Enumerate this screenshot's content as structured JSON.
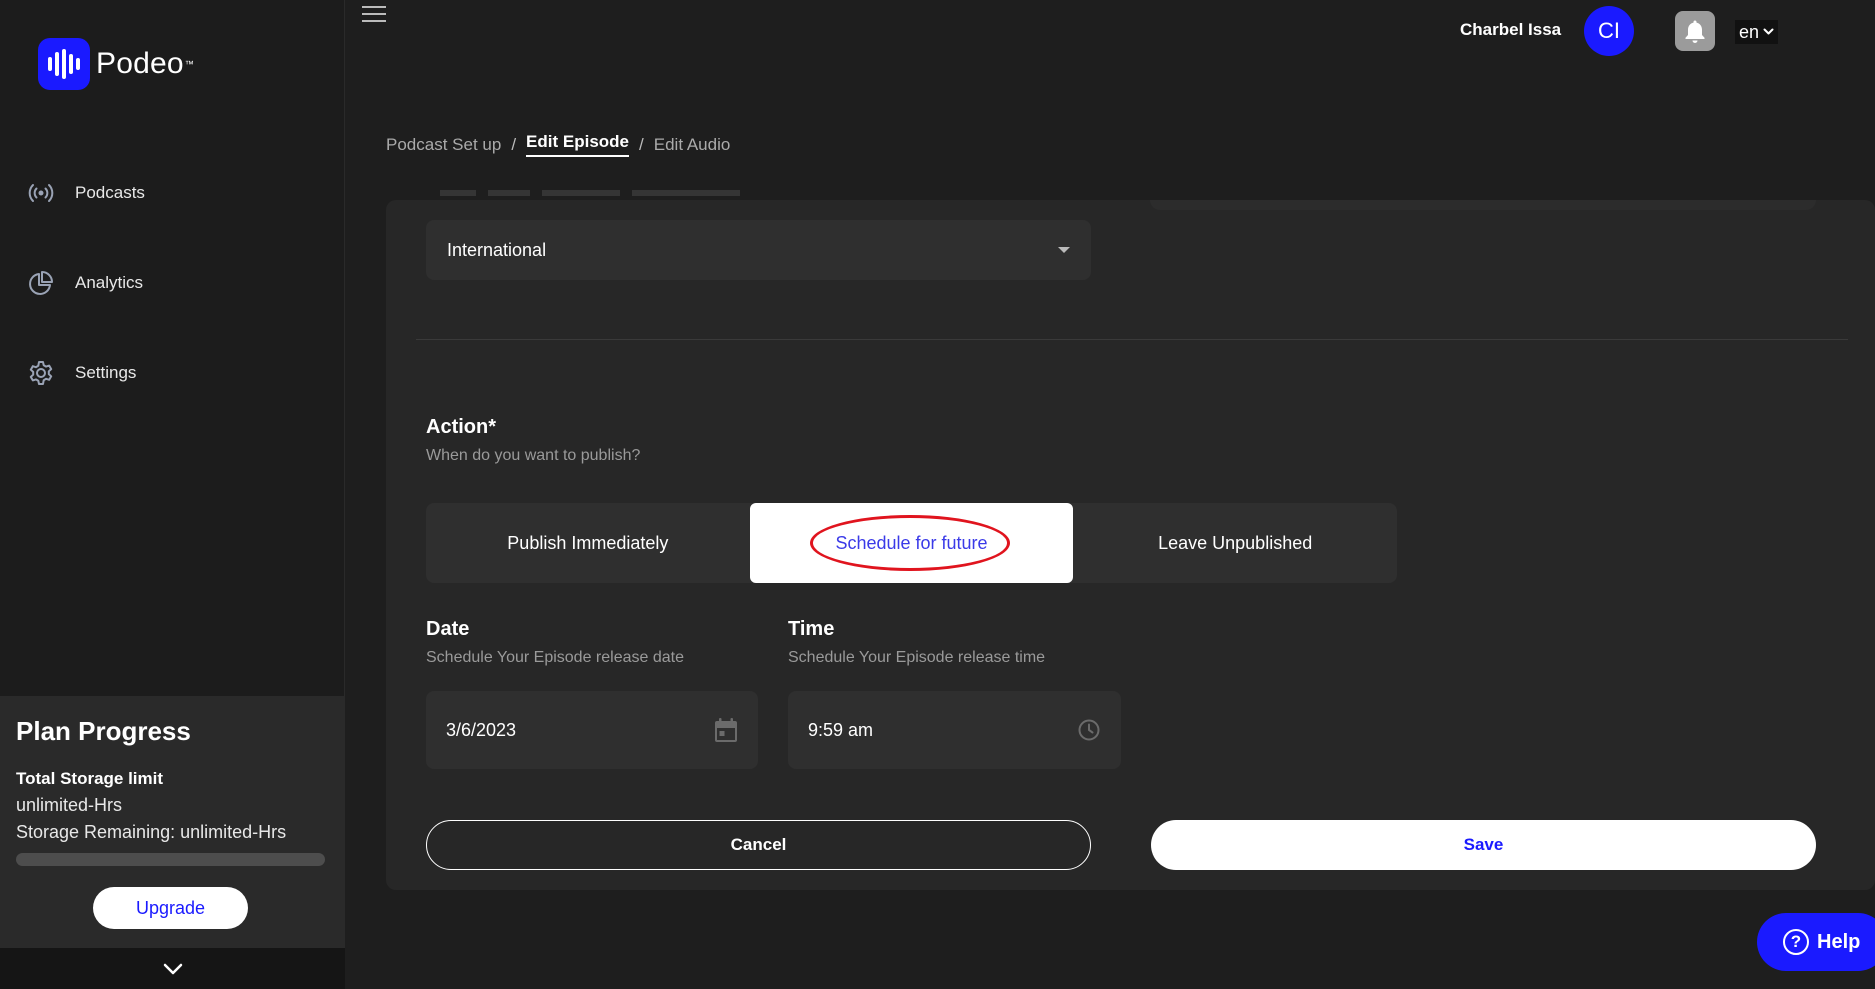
{
  "brand": {
    "name": "Podeo",
    "tm": "™",
    "color": "#1a1aff"
  },
  "sidebar": {
    "items": [
      {
        "label": "Podcasts",
        "icon": "broadcast-icon"
      },
      {
        "label": "Analytics",
        "icon": "pie-chart-icon"
      },
      {
        "label": "Settings",
        "icon": "gear-icon"
      }
    ],
    "plan": {
      "title": "Plan Progress",
      "storage_label": "Total Storage limit",
      "storage_value": "unlimited-Hrs",
      "remaining": "Storage Remaining: unlimited-Hrs",
      "upgrade_label": "Upgrade"
    }
  },
  "header": {
    "user_name": "Charbel Issa",
    "avatar_initials": "CI",
    "language": "en"
  },
  "breadcrumb": [
    "Podcast Set up",
    "Edit Episode",
    "Edit Audio"
  ],
  "form": {
    "region_value": "International",
    "action": {
      "title": "Action*",
      "subtitle": "When do you want to publish?",
      "options": [
        "Publish Immediately",
        "Schedule for future",
        "Leave Unpublished"
      ],
      "selected": "Schedule for future"
    },
    "date": {
      "title": "Date",
      "subtitle": "Schedule Your Episode release date",
      "value": "3/6/2023"
    },
    "time": {
      "title": "Time",
      "subtitle": "Schedule Your Episode release time",
      "value": "9:59 am"
    },
    "cancel_label": "Cancel",
    "save_label": "Save"
  },
  "help_label": "Help"
}
